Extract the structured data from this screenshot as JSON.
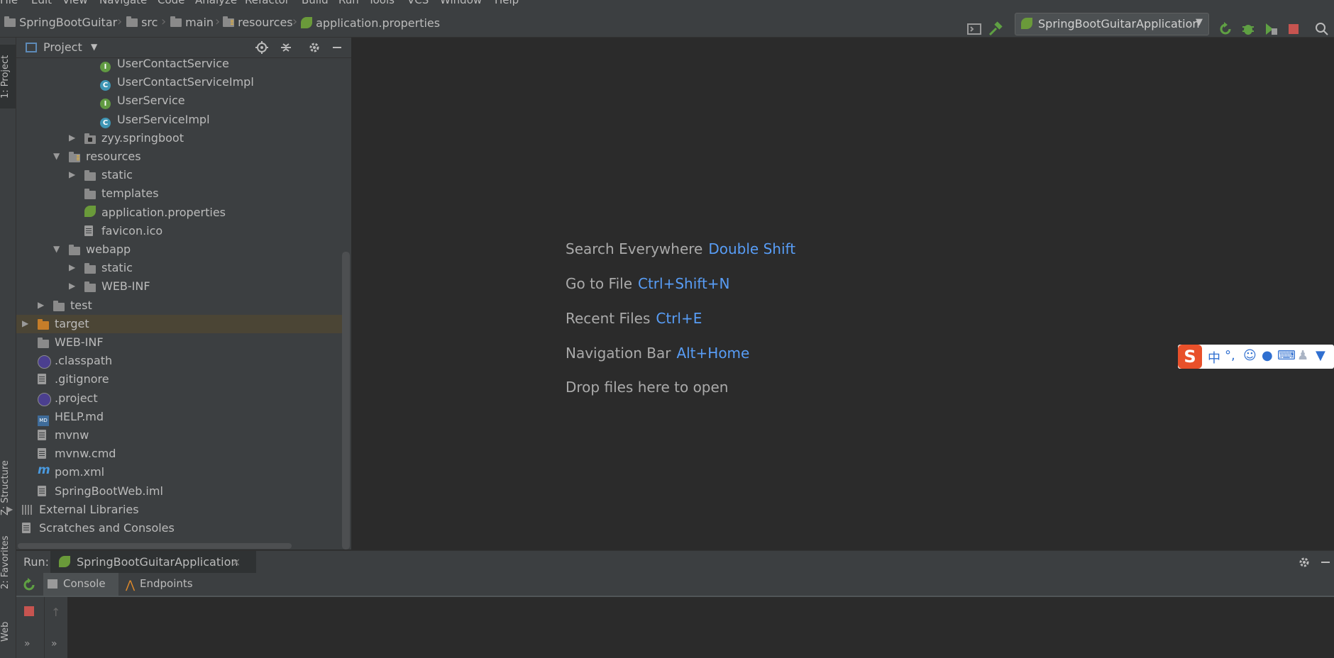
{
  "menu": [
    "File",
    "Edit",
    "View",
    "Navigate",
    "Code",
    "Analyze",
    "Refactor",
    "Build",
    "Run",
    "Tools",
    "VCS",
    "Window",
    "Help"
  ],
  "breadcrumb": [
    "SpringBootGuitar",
    "src",
    "main",
    "resources",
    "application.properties"
  ],
  "run_config": "SpringBootGuitarApplication",
  "left_tabs": {
    "project": "1: Project",
    "structure": "Z: Structure",
    "favorites": "2: Favorites",
    "web": "Web"
  },
  "project_panel": {
    "title": "Project"
  },
  "tree": [
    {
      "label": "UserContactService",
      "icon": "interface-icon",
      "depth": 4,
      "arrow": ""
    },
    {
      "label": "UserContactServiceImpl",
      "icon": "class-icon",
      "depth": 4,
      "arrow": ""
    },
    {
      "label": "UserService",
      "icon": "interface-icon",
      "depth": 4,
      "arrow": ""
    },
    {
      "label": "UserServiceImpl",
      "icon": "class-icon",
      "depth": 4,
      "arrow": ""
    },
    {
      "label": "zyy.springboot",
      "icon": "package-icon",
      "depth": 3,
      "arrow": "▶"
    },
    {
      "label": "resources",
      "icon": "resources-folder-icon",
      "depth": 2,
      "arrow": "▼"
    },
    {
      "label": "static",
      "icon": "folder-icon",
      "depth": 3,
      "arrow": "▶"
    },
    {
      "label": "templates",
      "icon": "folder-icon",
      "depth": 3,
      "arrow": ""
    },
    {
      "label": "application.properties",
      "icon": "spring-icon",
      "depth": 3,
      "arrow": ""
    },
    {
      "label": "favicon.ico",
      "icon": "file-icon",
      "depth": 3,
      "arrow": ""
    },
    {
      "label": "webapp",
      "icon": "folder-icon",
      "depth": 2,
      "arrow": "▼"
    },
    {
      "label": "static",
      "icon": "folder-icon",
      "depth": 3,
      "arrow": "▶"
    },
    {
      "label": "WEB-INF",
      "icon": "folder-icon",
      "depth": 3,
      "arrow": "▶"
    },
    {
      "label": "test",
      "icon": "folder-icon",
      "depth": 1,
      "arrow": "▶"
    },
    {
      "label": "target",
      "icon": "excluded-folder-icon",
      "depth": 0,
      "arrow": "▶"
    },
    {
      "label": "WEB-INF",
      "icon": "folder-icon",
      "depth": 0,
      "arrow": ""
    },
    {
      "label": ".classpath",
      "icon": "eclipse-icon",
      "depth": 0,
      "arrow": ""
    },
    {
      "label": ".gitignore",
      "icon": "file-icon",
      "depth": 0,
      "arrow": ""
    },
    {
      "label": ".project",
      "icon": "eclipse-icon",
      "depth": 0,
      "arrow": ""
    },
    {
      "label": "HELP.md",
      "icon": "markdown-icon",
      "depth": 0,
      "arrow": ""
    },
    {
      "label": "mvnw",
      "icon": "file-icon",
      "depth": 0,
      "arrow": ""
    },
    {
      "label": "mvnw.cmd",
      "icon": "file-icon",
      "depth": 0,
      "arrow": ""
    },
    {
      "label": "pom.xml",
      "icon": "maven-icon",
      "depth": 0,
      "arrow": ""
    },
    {
      "label": "SpringBootWeb.iml",
      "icon": "file-icon",
      "depth": 0,
      "arrow": ""
    },
    {
      "label": "External Libraries",
      "icon": "libraries-icon",
      "depth": -1,
      "arrow": "▶"
    },
    {
      "label": "Scratches and Consoles",
      "icon": "scratches-icon",
      "depth": -1,
      "arrow": ""
    }
  ],
  "editor_hints": [
    {
      "text": "Search Everywhere",
      "key": "Double Shift"
    },
    {
      "text": "Go to File",
      "key": "Ctrl+Shift+N"
    },
    {
      "text": "Recent Files",
      "key": "Ctrl+E"
    },
    {
      "text": "Navigation Bar",
      "key": "Alt+Home"
    },
    {
      "text": "Drop files here to open",
      "key": ""
    }
  ],
  "run_panel": {
    "label": "Run:",
    "tab": "SpringBootGuitarApplication",
    "console": "Console",
    "endpoints": "Endpoints"
  },
  "ime": {
    "lang": "中",
    "punct": "°,"
  }
}
